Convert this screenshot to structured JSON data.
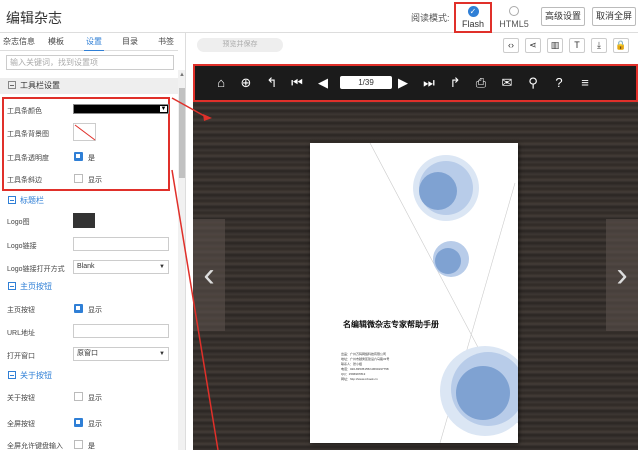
{
  "app_title": "编辑杂志",
  "read_mode": {
    "label": "阅读模式:",
    "options": [
      "Flash",
      "HTML5"
    ],
    "selected": "Flash"
  },
  "buttons": {
    "advanced": "高级设置",
    "cancel_fullscreen": "取消全屏"
  },
  "tabs": [
    "杂志信息",
    "模板",
    "设置",
    "目录",
    "书签"
  ],
  "active_tab": "设置",
  "search_placeholder": "输入关键词，找到设置项",
  "toolbar_section": {
    "title": "工具栏设置",
    "color_label": "工具条颜色",
    "bg_label": "工具条背景图",
    "transparency_label": "工具条透明度",
    "transparency_value": "是",
    "border_label": "工具条斜边",
    "border_value": "显示"
  },
  "title_section": {
    "title": "标题栏",
    "logo_label": "Logo图",
    "logo_link_label": "Logo链接",
    "logo_open_label": "Logo链接打开方式",
    "logo_open_value": "Blank"
  },
  "home_section": {
    "title": "主页按钮",
    "home_btn_label": "主页按钮",
    "home_btn_value": "显示",
    "url_label": "URL地址",
    "open_label": "打开窗口",
    "open_value": "原窗口"
  },
  "about_section": {
    "title": "关于按钮",
    "about_label": "关于按钮",
    "about_value": "显示",
    "fullscreen_label": "全屏按钮",
    "fullscreen_value": "显示",
    "fs_keyboard_label": "全屏允许键盘输入",
    "fs_keyboard_value": "是"
  },
  "preview": {
    "save_label": "预览并保存",
    "page_indicator": "1/39"
  },
  "document": {
    "title": "名编辑微杂志专家帮助手册",
    "info_lines": [
      "出品：广州万码网络科技有限公司",
      "地址：广州市越秀区建设六马路33号",
      "联系人：张小姐",
      "电话：020-83535155/13660197758",
      "QQ：1596997813",
      "网址：http://www.mbook.cn"
    ]
  },
  "colors": {
    "accent": "#2f7fd6",
    "highlight": "#e0302a",
    "toolbar_bg": "#1b1b1b"
  }
}
